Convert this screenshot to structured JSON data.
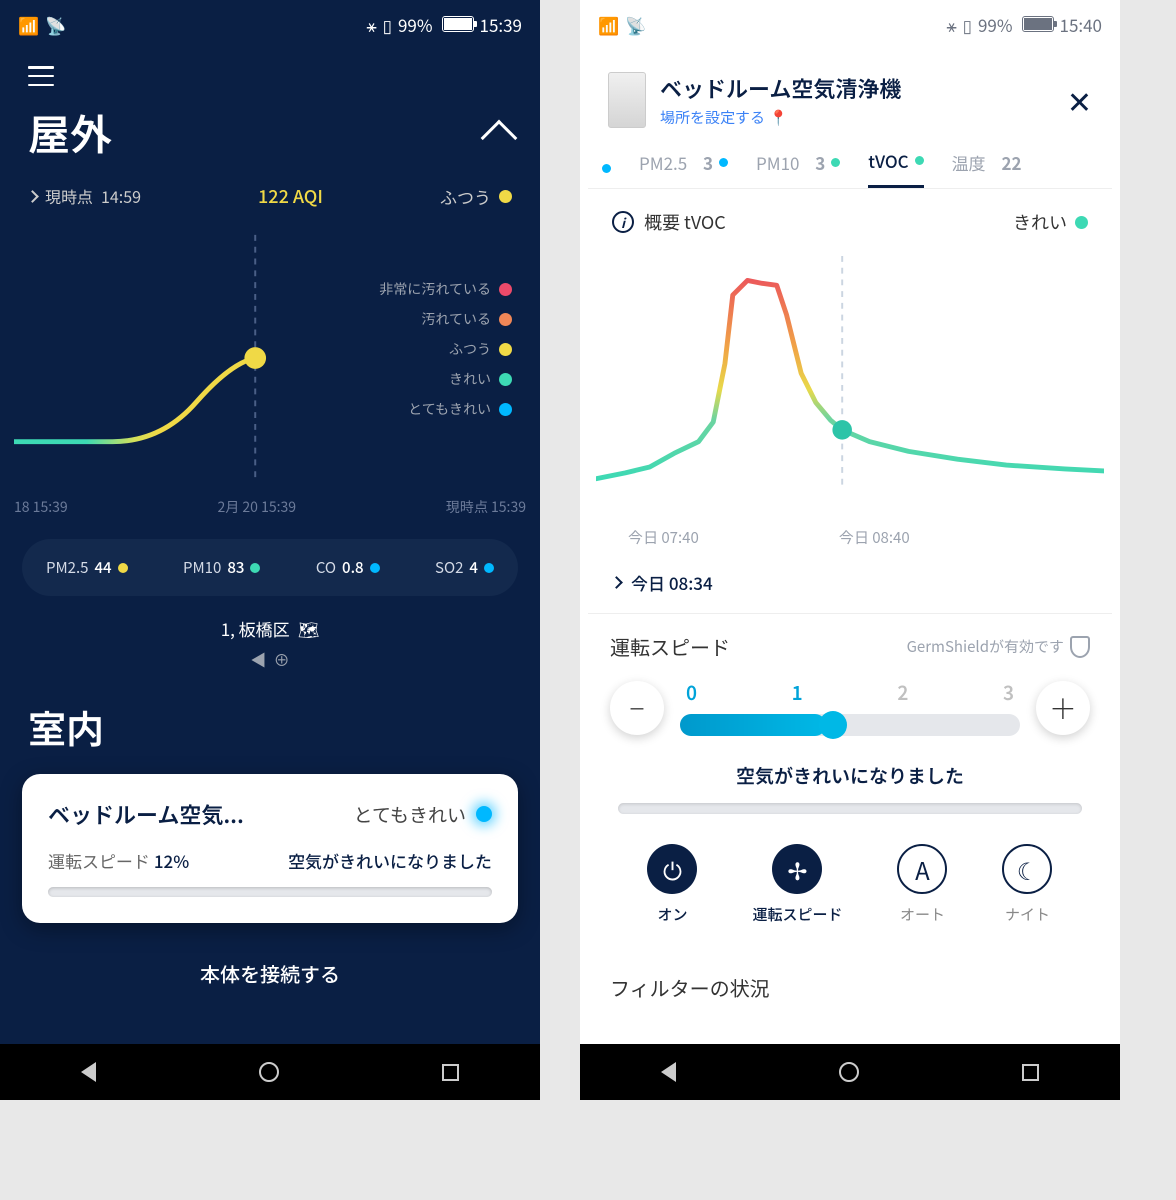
{
  "left": {
    "status": {
      "battery": "99%",
      "time": "15:39"
    },
    "outdoor_title": "屋外",
    "aqi": {
      "time_prefix": "現時点",
      "time": "14:59",
      "value": "122 AQI",
      "status": "ふつう"
    },
    "legend": [
      {
        "label": "非常に汚れている",
        "color": "#ec4a6a"
      },
      {
        "label": "汚れている",
        "color": "#f08757"
      },
      {
        "label": "ふつう",
        "color": "#f0d946"
      },
      {
        "label": "きれい",
        "color": "#3dd9b4"
      },
      {
        "label": "とてもきれい",
        "color": "#00b8ff"
      }
    ],
    "xlabels": [
      "18 15:39",
      "2月 20 15:39",
      "現時点 15:39"
    ],
    "pollutants": [
      {
        "name": "PM2.5",
        "val": "44",
        "color": "#f0d946"
      },
      {
        "name": "PM10",
        "val": "83",
        "color": "#3dd9b4"
      },
      {
        "name": "CO",
        "val": "0.8",
        "color": "#00b8ff"
      },
      {
        "name": "SO2",
        "val": "4",
        "color": "#00b8ff"
      }
    ],
    "location": "1, 板橋区",
    "indoor_title": "室内",
    "device": {
      "name": "ベッドルーム空気...",
      "status": "とてもきれい",
      "speed_label": "運転スピード",
      "speed": "12%",
      "msg": "空気がきれいになりました"
    },
    "connect": "本体を接続する"
  },
  "right": {
    "status": {
      "battery": "99%",
      "time": "15:40"
    },
    "device_name": "ベッドルーム空気清浄機",
    "set_location": "場所を設定する",
    "tabs": [
      {
        "label": "PM2.5",
        "val": "3",
        "color": "#00b8ff"
      },
      {
        "label": "PM10",
        "val": "3",
        "color": "#3dd9b4"
      },
      {
        "label": "tVOC",
        "val": "",
        "color": "#3dd9b4",
        "active": true
      },
      {
        "label": "温度",
        "val": "22",
        "color": ""
      }
    ],
    "overview": {
      "label": "概要 tVOC",
      "status": "きれい",
      "color": "#3dd9b4"
    },
    "xlabels": [
      "今日 07:40",
      "今日 08:40"
    ],
    "time_nav": "今日 08:34",
    "speed": {
      "title": "運転スピード",
      "germ": "GermShieldが有効です",
      "marks": [
        "0",
        "1",
        "2",
        "3"
      ],
      "current": 1
    },
    "clean_msg": "空気がきれいになりました",
    "modes": [
      {
        "label": "オン",
        "icon": "⏻",
        "active": true
      },
      {
        "label": "運転スピード",
        "icon": "✢",
        "active": true
      },
      {
        "label": "オート",
        "icon": "Ⓐ",
        "active": false
      },
      {
        "label": "ナイト",
        "icon": "☾",
        "active": false
      }
    ],
    "filter_title": "フィルターの状況"
  },
  "chart_data": [
    {
      "type": "line",
      "title": "Outdoor AQI",
      "x": [
        "18 15:39",
        "2月 20 15:39",
        "現時点 15:39"
      ],
      "y": [
        45,
        45,
        122
      ],
      "ylim": [
        0,
        500
      ],
      "current_marker": "現時点 15:39",
      "legend_levels": [
        "非常に汚れている",
        "汚れている",
        "ふつう",
        "きれい",
        "とてもきれい"
      ]
    },
    {
      "type": "line",
      "title": "tVOC",
      "x": [
        "07:40",
        "07:55",
        "08:05",
        "08:10",
        "08:15",
        "08:20",
        "08:25",
        "08:34",
        "08:40",
        "09:00",
        "09:40"
      ],
      "y": [
        30,
        28,
        35,
        160,
        165,
        140,
        95,
        55,
        42,
        38,
        36
      ],
      "current_marker": "08:34",
      "xlabel": "今日",
      "status": "きれい"
    }
  ]
}
